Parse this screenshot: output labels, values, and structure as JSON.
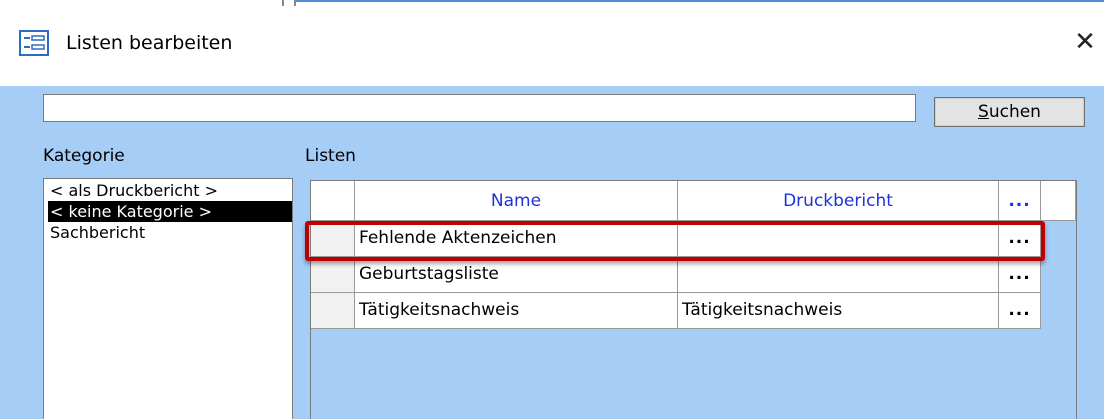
{
  "window": {
    "title": "Listen bearbeiten",
    "close_glyph": "✕"
  },
  "search": {
    "value": "",
    "button_label_prefix": "S",
    "button_label_rest": "uchen"
  },
  "kategorie": {
    "label": "Kategorie",
    "items": [
      {
        "label": "< als Druckbericht >",
        "selected": false
      },
      {
        "label": "< keine Kategorie >",
        "selected": true
      },
      {
        "label": "Sachbericht",
        "selected": false
      }
    ]
  },
  "listen": {
    "label": "Listen",
    "columns": {
      "name": "Name",
      "druckbericht": "Druckbericht",
      "edit": "..."
    },
    "rows": [
      {
        "name": "Fehlende Aktenzeichen",
        "druckbericht": "",
        "edit": "..."
      },
      {
        "name": "Geburtstagsliste",
        "druckbericht": "",
        "edit": "..."
      },
      {
        "name": "Tätigkeitsnachweis",
        "druckbericht": "Tätigkeitsnachweis",
        "edit": "..."
      }
    ]
  },
  "colors": {
    "client_background": "#a5cdf6",
    "header_text": "#1d32d8",
    "highlight": "#c00000"
  }
}
